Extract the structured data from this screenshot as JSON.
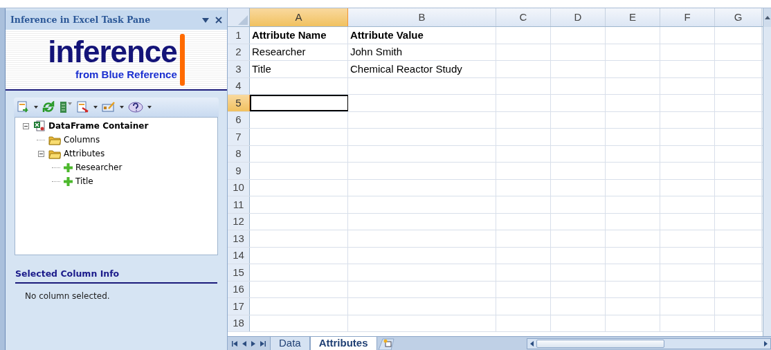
{
  "task_pane": {
    "title": "Inference in Excel Task Pane",
    "logo": {
      "word": "inference",
      "tagline": "from Blue Reference"
    },
    "tree": [
      {
        "label": "DataFrame Container",
        "kind": "container",
        "expanded": true,
        "children": [
          {
            "label": "Columns",
            "kind": "folder"
          },
          {
            "label": "Attributes",
            "kind": "folder",
            "expanded": true,
            "children": [
              {
                "label": "Researcher",
                "kind": "item"
              },
              {
                "label": "Title",
                "kind": "item"
              }
            ]
          }
        ]
      }
    ],
    "info_section": {
      "heading": "Selected Column Info",
      "text": "No column selected."
    }
  },
  "sheet": {
    "columns": [
      {
        "label": "A",
        "selected": true
      },
      {
        "label": "B",
        "selected": false
      },
      {
        "label": "C",
        "selected": false
      },
      {
        "label": "D",
        "selected": false
      },
      {
        "label": "E",
        "selected": false
      },
      {
        "label": "F",
        "selected": false
      },
      {
        "label": "G",
        "selected": false
      }
    ],
    "rows": [
      {
        "number": "1",
        "selected": false,
        "cells": [
          {
            "text": "Attribute Name",
            "bold": true
          },
          {
            "text": "Attribute Value",
            "bold": true
          }
        ]
      },
      {
        "number": "2",
        "selected": false,
        "cells": [
          {
            "text": "Researcher",
            "bold": false
          },
          {
            "text": "John Smith",
            "bold": false
          }
        ]
      },
      {
        "number": "3",
        "selected": false,
        "cells": [
          {
            "text": "Title",
            "bold": false
          },
          {
            "text": "Chemical Reactor Study",
            "bold": false
          }
        ]
      },
      {
        "number": "4",
        "selected": false
      },
      {
        "number": "5",
        "selected": true
      },
      {
        "number": "6",
        "selected": false
      },
      {
        "number": "7",
        "selected": false
      },
      {
        "number": "8",
        "selected": false
      },
      {
        "number": "9",
        "selected": false
      },
      {
        "number": "10",
        "selected": false
      },
      {
        "number": "11",
        "selected": false
      },
      {
        "number": "12",
        "selected": false
      },
      {
        "number": "13",
        "selected": false
      },
      {
        "number": "14",
        "selected": false
      },
      {
        "number": "15",
        "selected": false
      },
      {
        "number": "16",
        "selected": false
      },
      {
        "number": "17",
        "selected": false
      },
      {
        "number": "18",
        "selected": false
      }
    ],
    "tabs": [
      {
        "label": "Data",
        "selected": false
      },
      {
        "label": "Attributes",
        "selected": true
      }
    ]
  }
}
